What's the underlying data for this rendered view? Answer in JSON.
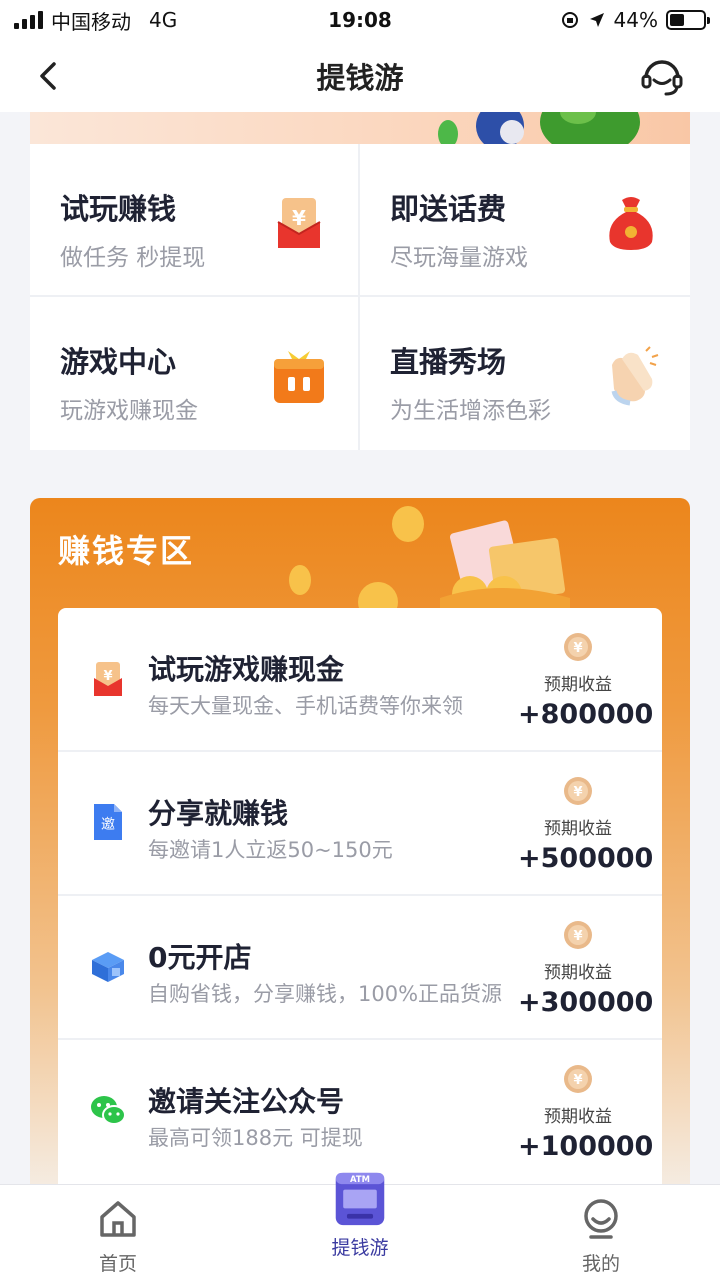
{
  "status_bar": {
    "carrier": "中国移动",
    "network": "4G",
    "time": "19:08",
    "battery": "44%",
    "battery_level": 0.44
  },
  "nav": {
    "title": "提钱游"
  },
  "features": [
    {
      "title": "试玩赚钱",
      "subtitle": "做任务 秒提现",
      "icon": "red-envelope-icon"
    },
    {
      "title": "即送话费",
      "subtitle": "尽玩海量游戏",
      "icon": "lucky-bag-icon"
    },
    {
      "title": "游戏中心",
      "subtitle": "玩游戏赚现金",
      "icon": "game-box-icon"
    },
    {
      "title": "直播秀场",
      "subtitle": "为生活增添色彩",
      "icon": "clapping-hands-icon"
    }
  ],
  "earn_zone": {
    "title": "赚钱专区",
    "items": [
      {
        "name": "试玩游戏赚现金",
        "desc": "每天大量现金、手机话费等你来领",
        "label": "预期收益",
        "amount": "+800000",
        "icon": "red-envelope-icon"
      },
      {
        "name": "分享就赚钱",
        "desc": "每邀请1人立返50~150元",
        "label": "预期收益",
        "amount": "+500000",
        "icon": "invite-doc-icon"
      },
      {
        "name": "0元开店",
        "desc": "自购省钱，分享赚钱，100%正品货源",
        "label": "预期收益",
        "amount": "+300000",
        "icon": "shop-icon"
      },
      {
        "name": "邀请关注公众号",
        "desc": "最高可领188元 可提现",
        "label": "预期收益",
        "amount": "+100000",
        "icon": "wechat-icon"
      }
    ],
    "coin_symbol": "¥",
    "invite_char": "邀"
  },
  "tabs": [
    {
      "label": "首页",
      "icon": "home-icon"
    },
    {
      "label": "提钱游",
      "icon": "atm-icon",
      "active": true
    },
    {
      "label": "我的",
      "icon": "profile-icon"
    }
  ],
  "atm_text": "ATM",
  "colors": {
    "accent_orange": "#ec861c",
    "tab_active": "#3a3aa0"
  }
}
